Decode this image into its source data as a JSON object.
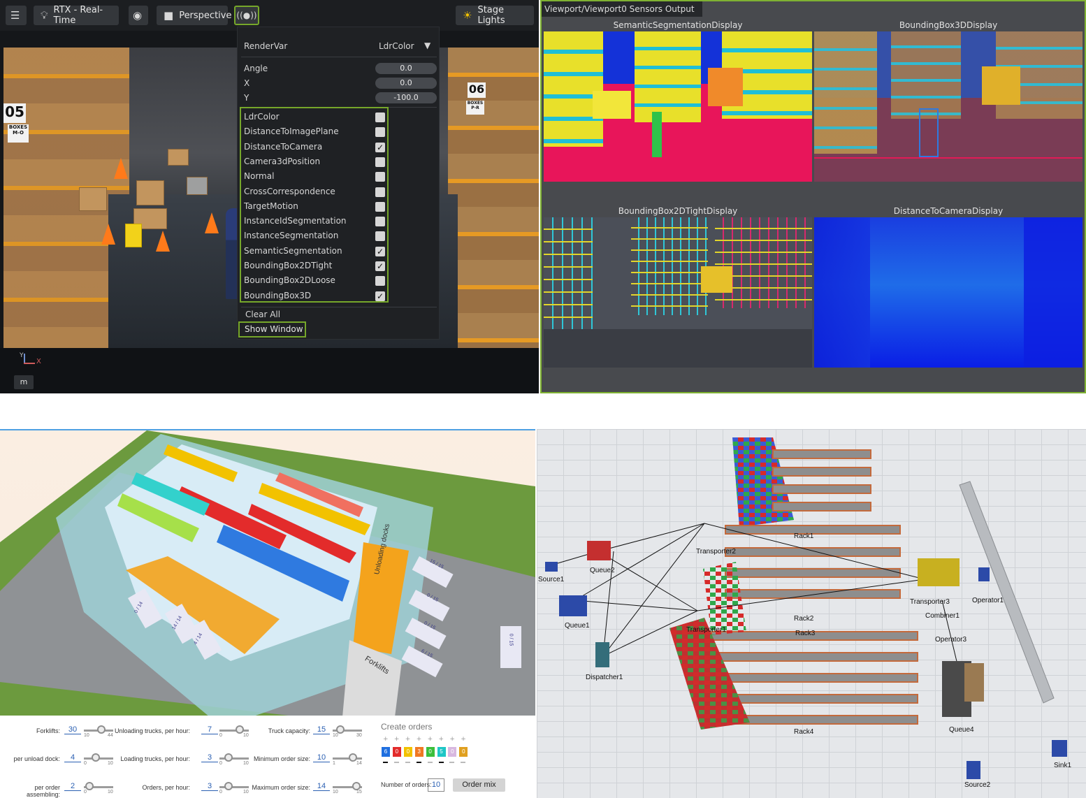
{
  "toolbar": {
    "settings_icon": "sliders-icon",
    "render_mode_label": "RTX - Real-Time",
    "render_mode_icon": "lightbulb-icon",
    "eye_icon": "eye-icon",
    "camera_label": "Perspective",
    "camera_icon": "camera-icon",
    "sensor_icon": "sensor-broadcast-icon",
    "stage_lights_label": "Stage Lights",
    "stage_lights_icon": "sun-icon"
  },
  "scene_signs": {
    "left": "05",
    "left_sub": "BOXES\nM-O",
    "right": "06",
    "right_sub": "BOXES\nP-R"
  },
  "viewport_footer": {
    "unit_label": "m",
    "axis_x": "X",
    "axis_y": "Y"
  },
  "render_menu": {
    "rendervar_label": "RenderVar",
    "rendervar_value": "LdrColor",
    "params": [
      {
        "label": "Angle",
        "value": "0.0"
      },
      {
        "label": "X",
        "value": "0.0"
      },
      {
        "label": "Y",
        "value": "-100.0"
      }
    ],
    "outputs": [
      {
        "label": "LdrColor",
        "checked": false
      },
      {
        "label": "DistanceToImagePlane",
        "checked": false
      },
      {
        "label": "DistanceToCamera",
        "checked": true
      },
      {
        "label": "Camera3dPosition",
        "checked": false
      },
      {
        "label": "Normal",
        "checked": false
      },
      {
        "label": "CrossCorrespondence",
        "checked": false
      },
      {
        "label": "TargetMotion",
        "checked": false
      },
      {
        "label": "InstanceIdSegmentation",
        "checked": false
      },
      {
        "label": "InstanceSegmentation",
        "checked": false
      },
      {
        "label": "SemanticSegmentation",
        "checked": true
      },
      {
        "label": "BoundingBox2DTight",
        "checked": true
      },
      {
        "label": "BoundingBox2DLoose",
        "checked": false
      },
      {
        "label": "BoundingBox3D",
        "checked": true
      }
    ],
    "clear_all": "Clear All",
    "show_window": "Show Window"
  },
  "sensor_output": {
    "tab_title": "Viewport/Viewport0 Sensors Output",
    "panels": [
      "SemanticSegmentationDisplay",
      "BoundingBox3DDisplay",
      "BoundingBox2DTightDisplay",
      "DistanceToCameraDisplay"
    ]
  },
  "warehouse_sim": {
    "unloading_docks_label": "Unloading docks",
    "forklifts_label": "Forklifts",
    "truck_labels": [
      "0 / 14",
      "14 / 14",
      "4 / 14",
      "15 / 15",
      "0 / 15",
      "0 / 15",
      "6 / 15",
      "0 / 15"
    ],
    "controls": [
      {
        "label": "Forklifts:",
        "value": "30",
        "min": "10",
        "max": "44",
        "pos": 0.6
      },
      {
        "label": "per unload dock:",
        "value": "4",
        "min": "0",
        "max": "10",
        "pos": 0.4
      },
      {
        "label": "per order assembling:",
        "value": "2",
        "min": "0",
        "max": "10",
        "pos": 0.2
      },
      {
        "label": "Unloading trucks, per hour:",
        "value": "7",
        "min": "0",
        "max": "10",
        "pos": 0.7
      },
      {
        "label": "Loading trucks, per hour:",
        "value": "3",
        "min": "0",
        "max": "10",
        "pos": 0.3
      },
      {
        "label": "Orders, per hour:",
        "value": "3",
        "min": "0",
        "max": "10",
        "pos": 0.3
      },
      {
        "label": "Truck capacity:",
        "value": "15",
        "min": "10",
        "max": "30",
        "pos": 0.25
      },
      {
        "label": "Minimum order size:",
        "value": "10",
        "min": "1",
        "max": "14",
        "pos": 0.7
      },
      {
        "label": "Maximum order size:",
        "value": "14",
        "min": "10",
        "max": "15",
        "pos": 0.8
      }
    ],
    "create_orders_title": "Create orders",
    "order_colors": [
      {
        "value": "6",
        "color": "#1f6fe0"
      },
      {
        "value": "0",
        "color": "#e32b2b"
      },
      {
        "value": "0",
        "color": "#f2c200"
      },
      {
        "value": "3",
        "color": "#f07822"
      },
      {
        "value": "0",
        "color": "#3bbf3b"
      },
      {
        "value": "5",
        "color": "#1ec6c6"
      },
      {
        "value": "0",
        "color": "#d8b8e0"
      },
      {
        "value": "0",
        "color": "#e0a020"
      }
    ],
    "number_of_orders_label": "Number of orders:",
    "number_of_orders_value": "10",
    "order_mix_button": "Order mix"
  },
  "flexsim": {
    "labels": [
      "Rack1",
      "Transporter2",
      "Source1",
      "Queue2",
      "Queue1",
      "Rack2",
      "Rack3",
      "Transporter1",
      "Transporter3",
      "Operator1",
      "Combiner1",
      "Operator3",
      "Dispatcher1",
      "Rack4",
      "Queue4",
      "Sink1",
      "Source2"
    ]
  },
  "colors": {
    "accent_green": "#7fb232",
    "dark_bg": "#1f2124",
    "link_blue": "#2a5fb2"
  }
}
